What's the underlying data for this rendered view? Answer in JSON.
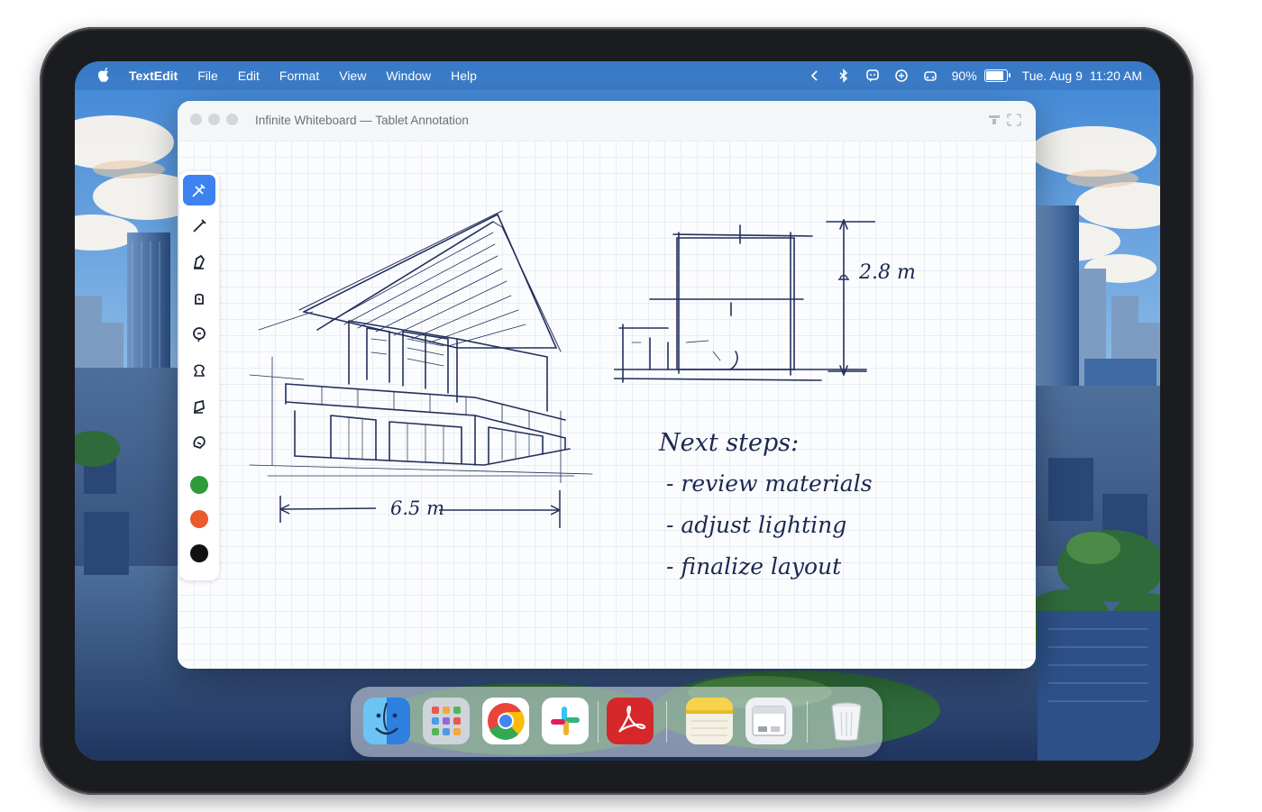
{
  "menubar": {
    "app_name": "TextEdit",
    "menus": [
      "File",
      "Edit",
      "Format",
      "View",
      "Window",
      "Help"
    ],
    "battery_percent": "90%",
    "battery_level": 0.9,
    "date": "Tue. Aug 9",
    "time": "11:20 AM",
    "status_icons": [
      "chevron-left-icon",
      "bluetooth-icon",
      "messages-icon",
      "airplay-icon",
      "car-icon"
    ]
  },
  "window": {
    "title": "Infinite Whiteboard — Tablet Annotation",
    "tools": [
      "pen-tool-icon",
      "pencil-tool-icon",
      "brush-tool-icon",
      "marker-tool-icon",
      "lasso-tool-icon",
      "shape-tool-icon",
      "highlighter-tool-icon",
      "eraser-tool-icon"
    ],
    "colors": [
      "#2e9a3a",
      "#ea5a2c",
      "#111111"
    ],
    "canvas": {
      "dimension_width": "6.5 m",
      "dimension_height": "2.8 m",
      "notes_heading": "Next steps:",
      "notes": [
        "- review materials",
        "- adjust lighting",
        "- finalize layout"
      ]
    }
  },
  "dock": {
    "apps": [
      "finder-icon",
      "launchpad-icon",
      "chrome-icon",
      "slack-icon",
      "acrobat-icon",
      "notes-icon",
      "preview-icon",
      "trash-icon"
    ]
  }
}
